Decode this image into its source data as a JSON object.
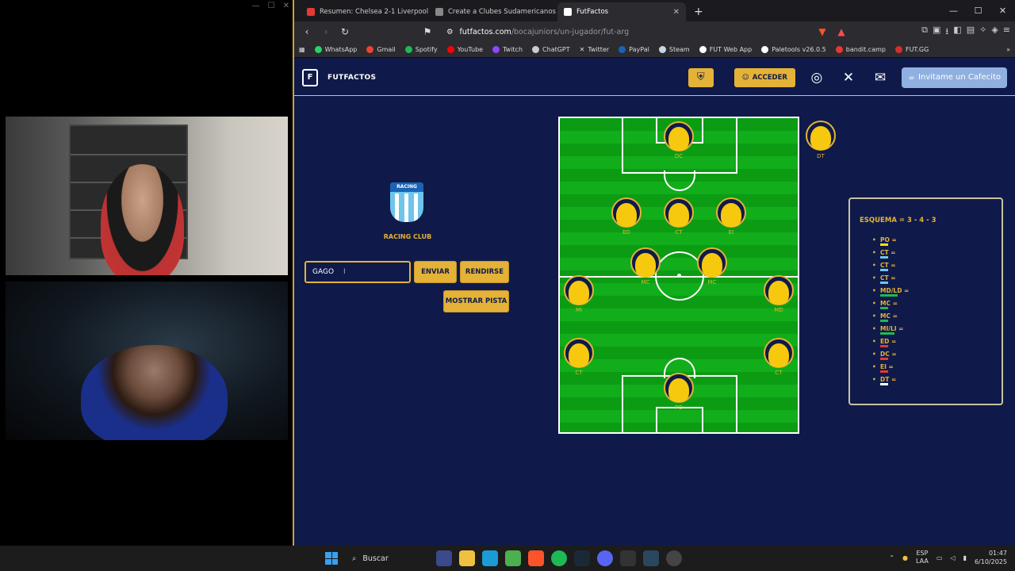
{
  "browser": {
    "tabs": [
      {
        "label": "Resumen: Chelsea 2-1 Liverpool | De",
        "favicon_color": "#e53935"
      },
      {
        "label": "Create a Clubes Sudamericanos Tier",
        "favicon_color": "#888888"
      },
      {
        "label": "FutFactos",
        "favicon_color": "#ffffff",
        "active": true
      }
    ],
    "url_host": "futfactos.com",
    "url_path": "/bocajuniors/un-jugador/fut-arg",
    "bookmarks": [
      {
        "label": "WhatsApp",
        "color": "#25d366"
      },
      {
        "label": "Gmail",
        "color": "#ea4335"
      },
      {
        "label": "Spotify",
        "color": "#1db954"
      },
      {
        "label": "YouTube",
        "color": "#ff0000"
      },
      {
        "label": "Twitch",
        "color": "#9146ff"
      },
      {
        "label": "ChatGPT",
        "color": "#cccccc"
      },
      {
        "label": "Twitter",
        "color": "#ffffff"
      },
      {
        "label": "PayPal",
        "color": "#003087"
      },
      {
        "label": "Steam",
        "color": "#c7d5e0"
      },
      {
        "label": "FUT Web App",
        "color": "#ffffff"
      },
      {
        "label": "Paletools v26.0.5",
        "color": "#ffffff"
      },
      {
        "label": "bandit.camp",
        "color": "#e53935"
      },
      {
        "label": "FUT.GG",
        "color": "#d32f2f"
      }
    ]
  },
  "site": {
    "name": "FUTFACTOS",
    "login_label": "ACCEDER",
    "coffee_label": "Invitame un Cafecito",
    "accent_color": "#e4b237",
    "background_color": "#0f1a4a"
  },
  "game": {
    "club_name": "RACING CLUB",
    "crest_text": "RACING",
    "guess_value": "GAGO",
    "send_label": "ENVIAR",
    "giveup_label": "RENDIRSE",
    "hint_label": "MOSTRAR PISTA",
    "coach_label": "DT"
  },
  "pitch": {
    "positions": [
      "PO",
      "CT",
      "CT",
      "CT",
      "MC",
      "MC",
      "MD",
      "MI",
      "ED",
      "EI",
      "DC"
    ]
  },
  "scheme": {
    "title": "ESQUEMA = 3 - 4 - 3",
    "rows": [
      {
        "label": "PO =",
        "color": "#f6e30e"
      },
      {
        "label": "CT =",
        "color": "#6ec5ec"
      },
      {
        "label": "CT =",
        "color": "#6ec5ec"
      },
      {
        "label": "CT =",
        "color": "#6ec5ec"
      },
      {
        "label": "MD/LD =",
        "color": "#1db954"
      },
      {
        "label": "MC =",
        "color": "#1db954"
      },
      {
        "label": "MC =",
        "color": "#1db954"
      },
      {
        "label": "MI/LI =",
        "color": "#1db954"
      },
      {
        "label": "ED =",
        "color": "#e53935"
      },
      {
        "label": "DC =",
        "color": "#e53935"
      },
      {
        "label": "EI =",
        "color": "#e53935"
      },
      {
        "label": "DT =",
        "color": "#ffffff"
      }
    ]
  },
  "taskbar": {
    "search_label": "Buscar",
    "lang_top": "ESP",
    "lang_bottom": "LAA",
    "time": "01:47",
    "date": "6/10/2025"
  }
}
